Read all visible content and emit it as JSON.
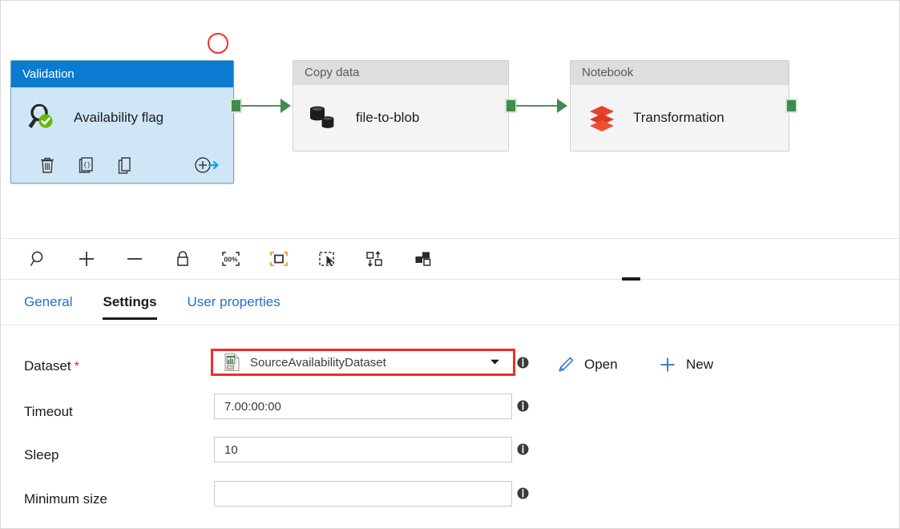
{
  "canvas": {
    "annotation": {
      "shape": "circle-highlight",
      "color": "#fc2b2b"
    },
    "nodes": [
      {
        "type_label": "Validation",
        "name": "Availability flag",
        "icon": "magnifier-check-icon",
        "selected": true,
        "actions": [
          {
            "label": "Delete",
            "icon": "trash-icon"
          },
          {
            "label": "Code",
            "icon": "code-braces-icon"
          },
          {
            "label": "Clone",
            "icon": "copy-icon"
          },
          {
            "label": "Add output",
            "icon": "add-arrow-icon"
          }
        ]
      },
      {
        "type_label": "Copy data",
        "name": "file-to-blob",
        "icon": "database-copy-icon",
        "selected": false
      },
      {
        "type_label": "Notebook",
        "name": "Transformation",
        "icon": "databricks-stack-icon",
        "selected": false
      }
    ],
    "connector_color": "#3f8b4f"
  },
  "toolbar": {
    "buttons": [
      {
        "label": "Zoom",
        "icon": "magnifier-icon"
      },
      {
        "label": "Zoom in",
        "icon": "plus-icon"
      },
      {
        "label": "Zoom out",
        "icon": "minus-icon"
      },
      {
        "label": "Lock canvas",
        "icon": "lock-icon"
      },
      {
        "label": "Zoom to 100%",
        "icon": "zoom-100-percent-icon"
      },
      {
        "label": "Zoom to fit",
        "icon": "fit-to-screen-icon"
      },
      {
        "label": "Select",
        "icon": "marquee-select-icon"
      },
      {
        "label": "Auto align",
        "icon": "auto-align-icon"
      },
      {
        "label": "Arrange",
        "icon": "arrange-shapes-icon"
      }
    ],
    "zoom_level_label": "100%"
  },
  "splitter": {
    "name": "panel-resize-grip"
  },
  "tabs": [
    {
      "label": "General",
      "active": false
    },
    {
      "label": "Settings",
      "active": true
    },
    {
      "label": "User properties",
      "active": false
    }
  ],
  "form": {
    "rows": [
      {
        "label": "Dataset",
        "required": true,
        "required_mark": "*",
        "control": "combobox",
        "value": "SourceAvailabilityDataset",
        "placeholder": "",
        "icon": "csv-dataset-icon",
        "caret": "chevron-down-icon",
        "highlighted": true,
        "info": "info-icon"
      },
      {
        "label": "Timeout",
        "required": false,
        "required_mark": "",
        "control": "textbox",
        "value": "7.00:00:00",
        "placeholder": "",
        "info": "info-icon"
      },
      {
        "label": "Sleep",
        "required": false,
        "required_mark": "",
        "control": "textbox",
        "value": "10",
        "placeholder": "",
        "info": "info-icon"
      },
      {
        "label": "Minimum size",
        "required": false,
        "required_mark": "",
        "control": "textbox",
        "value": "",
        "placeholder": "",
        "info": "info-icon"
      }
    ],
    "actions": [
      {
        "label": "Open",
        "icon": "pencil-icon"
      },
      {
        "label": "New",
        "icon": "plus-icon"
      }
    ]
  },
  "colors": {
    "accent_blue": "#0b7ad1",
    "link_blue": "#1f6fd0",
    "highlight_red": "#ef2c2c",
    "connector_green": "#3f8b4f",
    "databricks_red": "#e8402a"
  }
}
